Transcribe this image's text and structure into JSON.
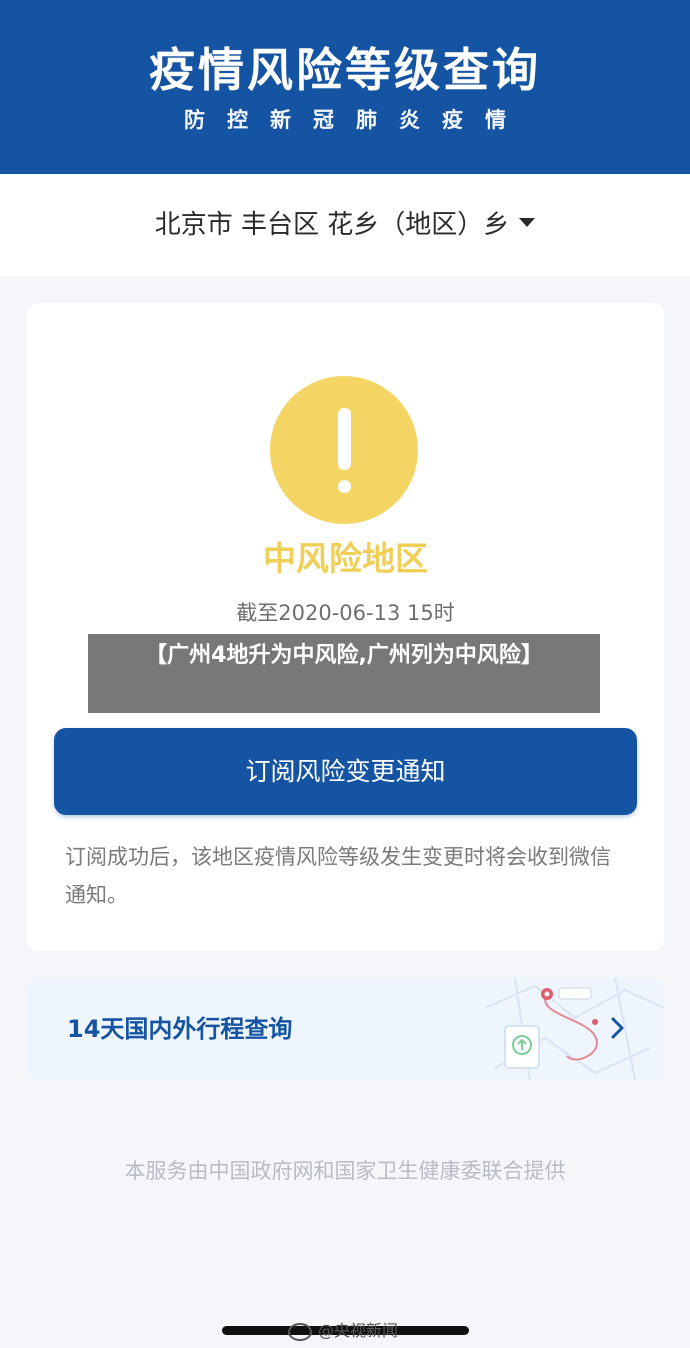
{
  "header": {
    "title": "疫情风险等级查询",
    "subtitle": "防控新冠肺炎疫情"
  },
  "region": {
    "label": "北京市 丰台区 花乡（地区）乡"
  },
  "risk_card": {
    "level": "中风险地区",
    "as_of": "截至2020-06-13 15时",
    "subscribe_button": "订阅风险变更通知",
    "subscribe_note": "订阅成功后，该地区疫情风险等级发生变更时将会收到微信通知。",
    "level_color": "#f4d564"
  },
  "itinerary": {
    "label": "14天国内外行程查询"
  },
  "footer": {
    "note": "本服务由中国政府网和国家卫生健康委联合提供"
  },
  "headline": {
    "text": "【广州4地升为中风险,广州列为中风险】"
  },
  "watermark": {
    "text": "@央视新闻"
  },
  "colors": {
    "brand_blue": "#1554a3",
    "alert_yellow": "#f4d564",
    "risk_text": "#f0cf57"
  }
}
